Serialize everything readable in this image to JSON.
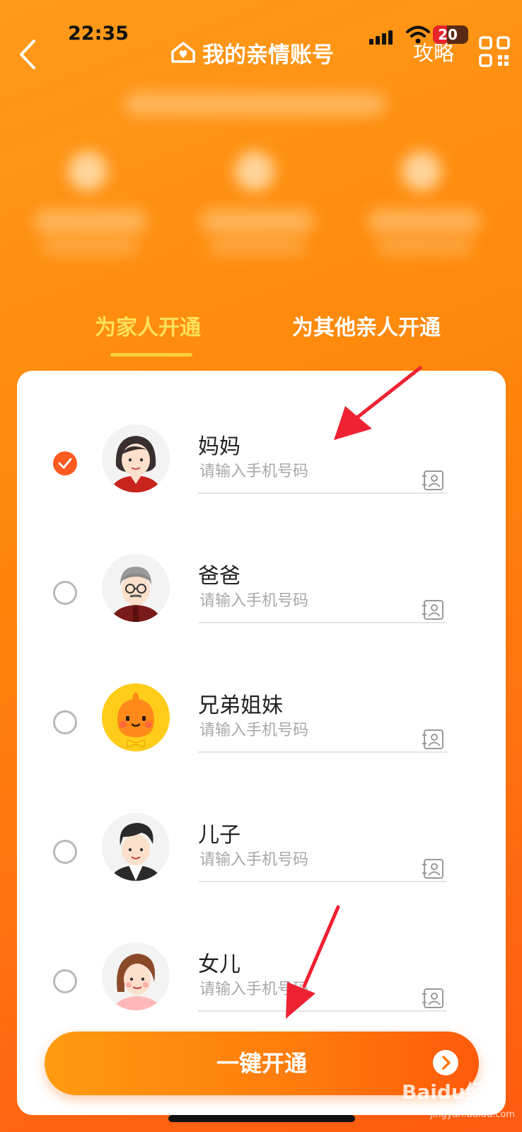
{
  "status_bar": {
    "time": "22:35",
    "battery": "20"
  },
  "nav": {
    "title": "我的亲情账号",
    "strategy": "攻略"
  },
  "tabs": [
    {
      "label": "为家人开通",
      "active": true
    },
    {
      "label": "为其他亲人开通",
      "active": false
    }
  ],
  "members": [
    {
      "name": "妈妈",
      "placeholder": "请输入手机号码",
      "selected": true,
      "avatar": "mother-avatar"
    },
    {
      "name": "爸爸",
      "placeholder": "请输入手机号码",
      "selected": false,
      "avatar": "father-avatar"
    },
    {
      "name": "兄弟姐妹",
      "placeholder": "请输入手机号码",
      "selected": false,
      "avatar": "sibling-mascot-avatar"
    },
    {
      "name": "儿子",
      "placeholder": "请输入手机号码",
      "selected": false,
      "avatar": "son-avatar"
    },
    {
      "name": "女儿",
      "placeholder": "请输入手机号码",
      "selected": false,
      "avatar": "daughter-avatar"
    }
  ],
  "submit_label": "一键开通",
  "watermark": {
    "main": "Baidu经验",
    "sub": "jingyan.baidu.com"
  },
  "colors": {
    "accent": "#ff5a1f",
    "tab_active": "#ffe05a",
    "background": "#ff8a0c",
    "annotation": "#ee2233"
  }
}
